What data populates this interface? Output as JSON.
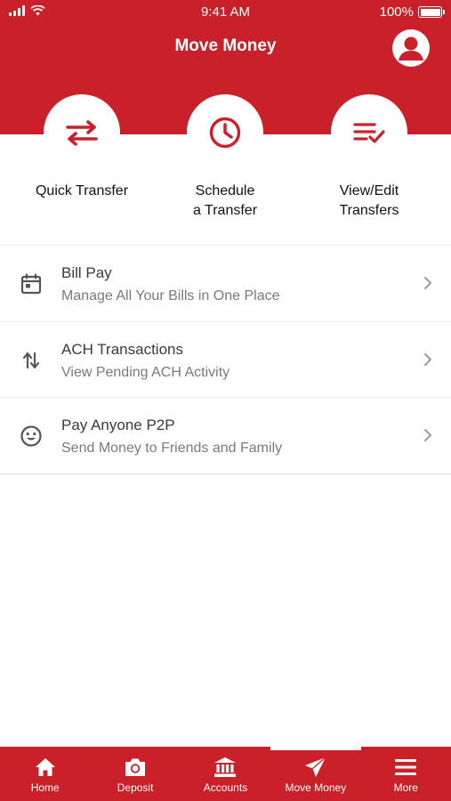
{
  "status_bar": {
    "time": "9:41 AM",
    "battery": "100%"
  },
  "header": {
    "title": "Move Money"
  },
  "quick_actions": [
    {
      "label": "Quick Transfer",
      "icon": "swap-arrows-icon"
    },
    {
      "label": "Schedule\na Transfer",
      "icon": "clock-icon"
    },
    {
      "label": "View/Edit\nTransfers",
      "icon": "list-check-icon"
    }
  ],
  "menu": [
    {
      "title": "Bill Pay",
      "subtitle": "Manage All Your Bills in One Place",
      "icon": "calendar-icon"
    },
    {
      "title": "ACH Transactions",
      "subtitle": "View Pending ACH Activity",
      "icon": "up-down-arrows-icon"
    },
    {
      "title": "Pay Anyone P2P",
      "subtitle": "Send Money to Friends and Family",
      "icon": "smiley-icon"
    }
  ],
  "tabbar": {
    "active": "Move Money",
    "tabs": [
      {
        "label": "Home",
        "icon": "home-icon"
      },
      {
        "label": "Deposit",
        "icon": "camera-icon"
      },
      {
        "label": "Accounts",
        "icon": "bank-icon"
      },
      {
        "label": "Move Money",
        "icon": "paper-plane-icon"
      },
      {
        "label": "More",
        "icon": "menu-icon"
      }
    ]
  },
  "colors": {
    "brand_red": "#c9202a",
    "text_dark": "#3a3a3a",
    "text_muted": "#7a7a7a"
  }
}
